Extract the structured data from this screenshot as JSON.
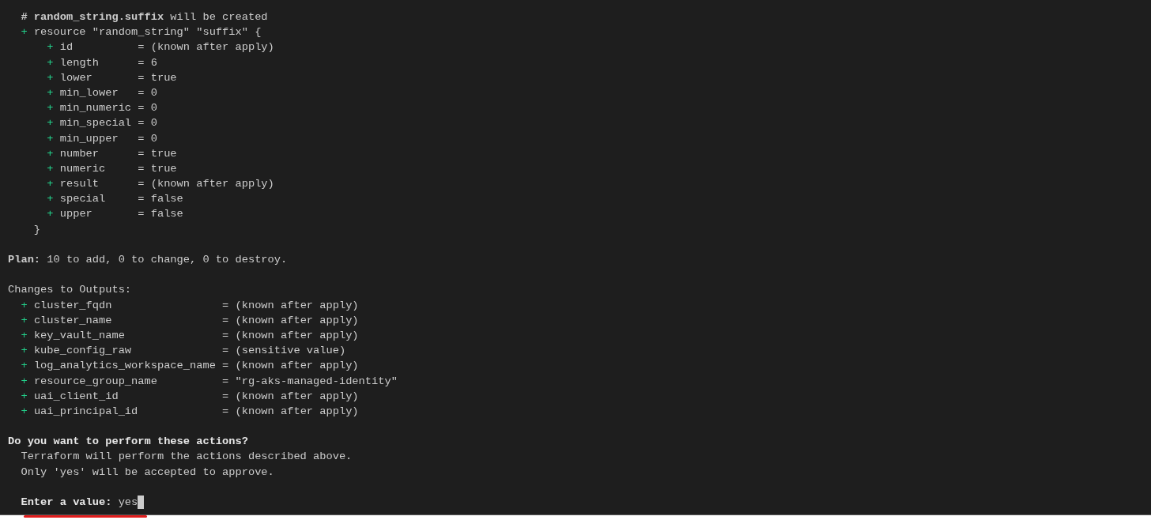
{
  "terminal": {
    "lines": [
      {
        "kind": "plain",
        "text": "  **# random_string.suffix** will be created"
      },
      {
        "kind": "add",
        "marker": "+",
        "text": "resource \"random_string\" \"suffix\" {",
        "closing": "}",
        "children": [
          {
            "kind": "add",
            "marker": "+",
            "text": "id          = (known after apply)"
          },
          {
            "kind": "add",
            "marker": "+",
            "text": "length      = 6"
          },
          {
            "kind": "add",
            "marker": "+",
            "text": "lower       = true"
          },
          {
            "kind": "add",
            "marker": "+",
            "text": "min_lower   = 0"
          },
          {
            "kind": "add",
            "marker": "+",
            "text": "min_numeric = 0"
          },
          {
            "kind": "add",
            "marker": "+",
            "text": "min_special = 0"
          },
          {
            "kind": "add",
            "marker": "+",
            "text": "min_upper   = 0"
          },
          {
            "kind": "add",
            "marker": "+",
            "text": "number      = true"
          },
          {
            "kind": "add",
            "marker": "+",
            "text": "numeric     = true"
          },
          {
            "kind": "add",
            "marker": "+",
            "text": "result      = (known after apply)"
          },
          {
            "kind": "add",
            "marker": "+",
            "text": "special     = false"
          },
          {
            "kind": "add",
            "marker": "+",
            "text": "upper       = false"
          }
        ]
      },
      {
        "kind": "blank"
      },
      {
        "kind": "plain",
        "text": "**Plan:** 10 to add, 0 to change, 0 to destroy."
      },
      {
        "kind": "blank"
      },
      {
        "kind": "plain",
        "text": "Changes to Outputs:"
      },
      {
        "kind": "add",
        "marker": "+",
        "text": "cluster_fqdn                 = (known after apply)"
      },
      {
        "kind": "add",
        "marker": "+",
        "text": "cluster_name                 = (known after apply)"
      },
      {
        "kind": "add",
        "marker": "+",
        "text": "key_vault_name               = (known after apply)"
      },
      {
        "kind": "add",
        "marker": "+",
        "text": "kube_config_raw              = (sensitive value)"
      },
      {
        "kind": "add",
        "marker": "+",
        "text": "log_analytics_workspace_name = (known after apply)"
      },
      {
        "kind": "add",
        "marker": "+",
        "text": "resource_group_name          = \"rg-aks-managed-identity\""
      },
      {
        "kind": "add",
        "marker": "+",
        "text": "uai_client_id                = (known after apply)"
      },
      {
        "kind": "add",
        "marker": "+",
        "text": "uai_principal_id             = (known after apply)"
      },
      {
        "kind": "blank"
      },
      {
        "kind": "heading",
        "text": "Do you want to perform these actions?"
      },
      {
        "kind": "plain",
        "text": "  Terraform will perform the actions described above."
      },
      {
        "kind": "plain",
        "text": "  Only 'yes' will be accepted to approve."
      },
      {
        "kind": "blank"
      },
      {
        "kind": "input",
        "label": "Enter a value:",
        "value": "yes"
      }
    ]
  }
}
